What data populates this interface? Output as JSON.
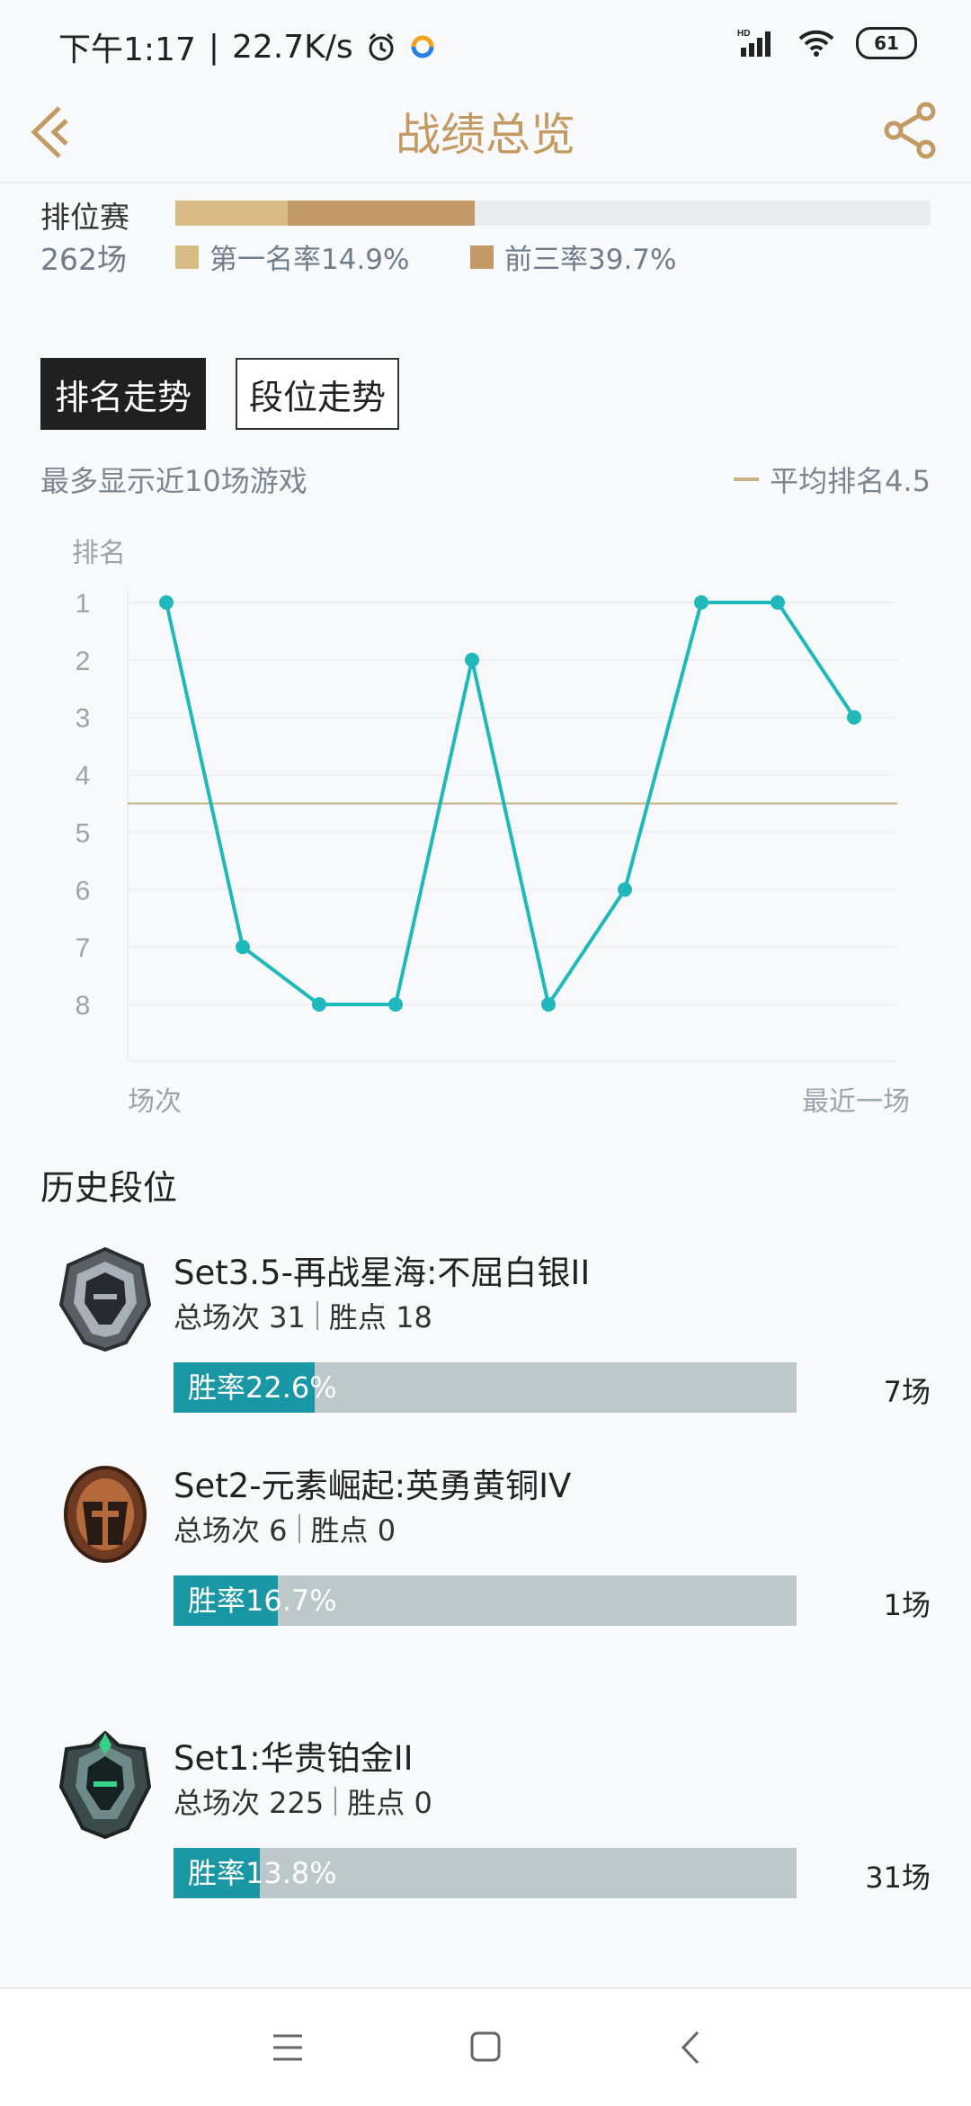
{
  "status": {
    "time": "下午1:17",
    "net_speed": "22.7K/s",
    "network_type": "HD",
    "battery": "61"
  },
  "header": {
    "title": "战绩总览"
  },
  "ranked": {
    "label": "排位赛",
    "count": "262场",
    "first_rate_label": "第一名率14.9%",
    "top3_rate_label": "前三率39.7%",
    "first_rate": 0.149,
    "top3_rate": 0.397,
    "first_color": "#d8bb85",
    "top3_color": "#c39a67"
  },
  "tabs": [
    {
      "label": "排名走势",
      "active": true
    },
    {
      "label": "段位走势",
      "active": false
    }
  ],
  "chart_note": "最多显示近10场游戏",
  "avg_label": "平均排名4.5",
  "chart_data": {
    "type": "line",
    "ylabel": "排名",
    "xlabel_left": "场次",
    "xlabel_right": "最近一场",
    "y_ticks": [
      "1",
      "2",
      "3",
      "4",
      "5",
      "6",
      "7",
      "8"
    ],
    "ylim": [
      1,
      8
    ],
    "y_inverted": true,
    "series": [
      {
        "values": [
          1,
          7,
          8,
          8,
          2,
          8,
          6,
          1,
          1,
          3
        ],
        "color": "#1fb8bb"
      }
    ],
    "reference_line": {
      "label": "平均排名4.5",
      "value": 4.5,
      "color": "#c9b18a"
    },
    "grid": true
  },
  "history": {
    "title": "历史段位",
    "seasons": [
      {
        "name": "Set3.5-再战星海:不屈白银II",
        "total_label": "总场次 31",
        "points_label": "胜点 18",
        "winrate_label": "胜率22.6%",
        "winrate": 0.226,
        "games": "7场",
        "badge_icon": "silver-rank-badge-icon"
      },
      {
        "name": "Set2-元素崛起:英勇黄铜IV",
        "total_label": "总场次 6",
        "points_label": "胜点 0",
        "winrate_label": "胜率16.7%",
        "winrate": 0.167,
        "games": "1场",
        "badge_icon": "bronze-rank-badge-icon"
      },
      {
        "name": "Set1:华贵铂金II",
        "total_label": "总场次 225",
        "points_label": "胜点 0",
        "winrate_label": "胜率13.8%",
        "winrate": 0.138,
        "games": "31场",
        "badge_icon": "platinum-rank-badge-icon"
      }
    ]
  },
  "colors": {
    "accent": "#c29a62",
    "line": "#1fb8bb",
    "winrate": "#1a97a5"
  }
}
